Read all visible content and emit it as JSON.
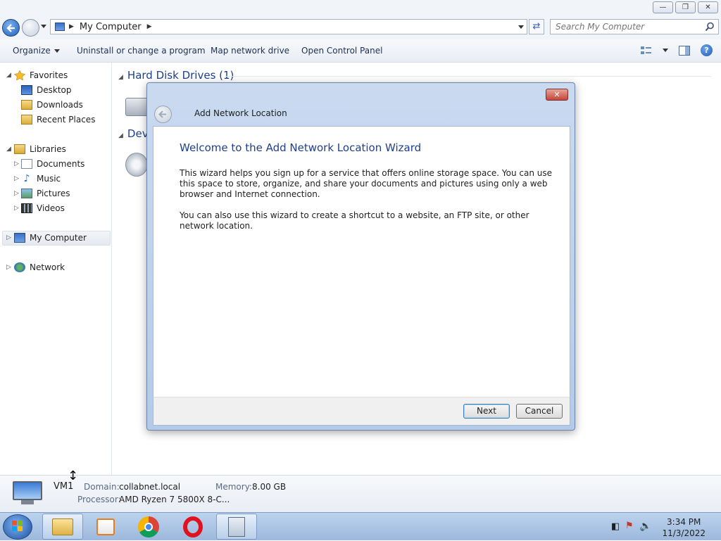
{
  "window": {
    "address": {
      "crumb": "My Computer"
    },
    "search": {
      "placeholder": "Search My Computer"
    }
  },
  "toolbar": {
    "organize": "Organize",
    "uninstall": "Uninstall or change a program",
    "map_drive": "Map network drive",
    "control_panel": "Open Control Panel"
  },
  "nav": {
    "favorites": "Favorites",
    "desktop": "Desktop",
    "downloads": "Downloads",
    "recent": "Recent Places",
    "libraries": "Libraries",
    "documents": "Documents",
    "music": "Music",
    "pictures": "Pictures",
    "videos": "Videos",
    "computer": "My Computer",
    "network": "Network"
  },
  "content": {
    "group_hdd": "Hard Disk Drives (1)",
    "group_dev": "Dev"
  },
  "details": {
    "name": "VM1",
    "domain_label": "Domain:",
    "domain_value": "collabnet.local",
    "memory_label": "Memory:",
    "memory_value": "8.00 GB",
    "processor_label": "Processor:",
    "processor_value": "AMD Ryzen 7 5800X 8-C..."
  },
  "dialog": {
    "title": "Add Network Location",
    "heading": "Welcome to the Add Network Location Wizard",
    "para1": "This wizard helps you sign up for a service that offers online storage space.  You can use this space to store, organize, and share your documents and pictures using only a web browser and Internet connection.",
    "para2": "You can also use this wizard to create a shortcut to a website, an FTP site, or other network location.",
    "next": "Next",
    "cancel": "Cancel"
  },
  "taskbar": {
    "time": "3:34 PM",
    "date": "11/3/2022"
  },
  "colors": {
    "link_blue": "#1e3f8a",
    "taskbar": "#9db8dc",
    "close_red": "#c4453a"
  }
}
